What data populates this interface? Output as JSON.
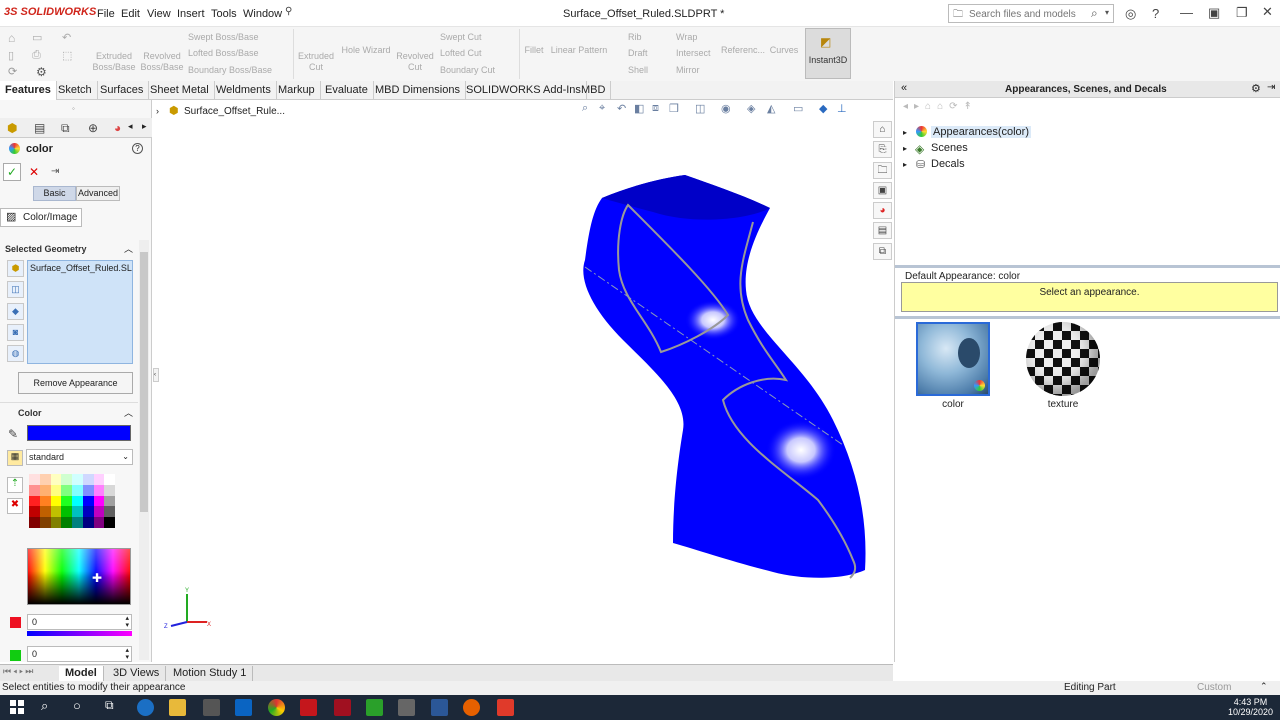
{
  "app": {
    "logo": "3S SOLIDWORKS",
    "menu": [
      "File",
      "Edit",
      "View",
      "Insert",
      "Tools",
      "Window"
    ],
    "document_title": "Surface_Offset_Ruled.SLDPRT *",
    "search_placeholder": "Search files and models"
  },
  "toolbar": {
    "extruded_boss": "Extruded Boss/Base",
    "revolved_boss": "Revolved Boss/Base",
    "swept_boss": "Swept Boss/Base",
    "lofted_boss": "Lofted Boss/Base",
    "boundary_boss": "Boundary Boss/Base",
    "extruded_cut": "Extruded Cut",
    "hole_wizard": "Hole Wizard",
    "revolved_cut": "Revolved Cut",
    "swept_cut": "Swept Cut",
    "lofted_cut": "Lofted Cut",
    "boundary_cut": "Boundary Cut",
    "fillet": "Fillet",
    "linear_pattern": "Linear Pattern",
    "rib": "Rib",
    "draft": "Draft",
    "shell": "Shell",
    "wrap": "Wrap",
    "intersect": "Intersect",
    "mirror": "Mirror",
    "reference": "Referenc...",
    "curves": "Curves",
    "instant3d": "Instant3D"
  },
  "tabs": [
    "Features",
    "Sketch",
    "Surfaces",
    "Sheet Metal",
    "Weldments",
    "Markup",
    "Evaluate",
    "MBD Dimensions",
    "SOLIDWORKS Add-Ins",
    "MBD"
  ],
  "property_manager": {
    "title": "color",
    "mode_basic": "Basic",
    "mode_advanced": "Advanced",
    "color_image_tab": "Color/Image",
    "selected_geometry_header": "Selected Geometry",
    "selected_item": "Surface_Offset_Ruled.SLDPRT",
    "remove_button": "Remove Appearance",
    "color_header": "Color",
    "color_value": "#0000FF",
    "swatch_set": "standard",
    "red_value": "0",
    "green_value": "0"
  },
  "graphics": {
    "breadcrumb": "Surface_Offset_Rule...",
    "model_color": "#0000FF"
  },
  "task_pane": {
    "title": "Appearances, Scenes, and Decals",
    "tree": [
      "Appearances(color)",
      "Scenes",
      "Decals"
    ],
    "default_appearance": "Default Appearance: color",
    "prompt": "Select an appearance.",
    "thumbnails": [
      {
        "label": "color"
      },
      {
        "label": "texture"
      }
    ]
  },
  "bottom_tabs": [
    "Model",
    "3D Views",
    "Motion Study 1"
  ],
  "status": {
    "message": "Select entities to modify their appearance",
    "mode": "Editing Part",
    "units": "Custom"
  },
  "taskbar": {
    "time": "4:43 PM",
    "date": "10/29/2020"
  }
}
